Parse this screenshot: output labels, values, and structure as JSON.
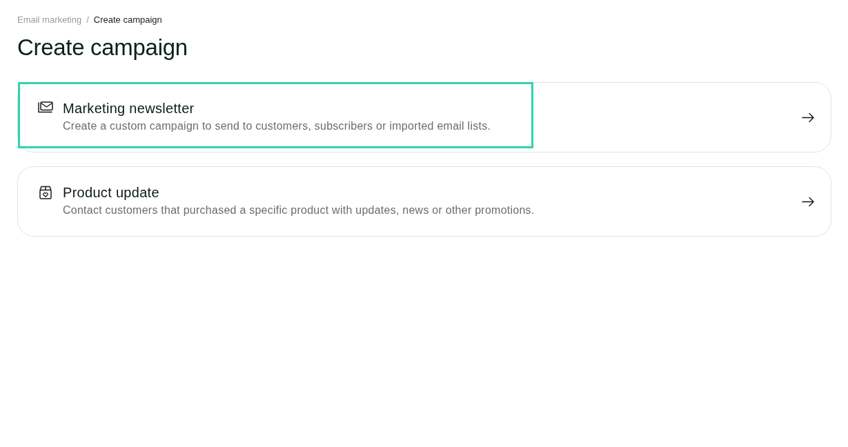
{
  "breadcrumb": [
    {
      "label": "Email marketing",
      "current": false
    },
    {
      "label": "Create campaign",
      "current": true
    }
  ],
  "breadcrumb_separator": "/",
  "title": "Create campaign",
  "options": [
    {
      "kind": "newsletter",
      "title": "Marketing newsletter",
      "description": "Create a custom campaign to send to customers, subscribers or imported email lists.",
      "highlighted": true
    },
    {
      "kind": "product",
      "title": "Product update",
      "description": "Contact customers that purchased a specific product with updates, news or other promotions.",
      "highlighted": false
    }
  ]
}
